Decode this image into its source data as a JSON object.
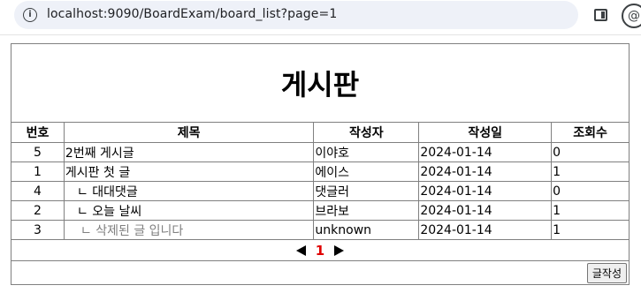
{
  "browser": {
    "url": "localhost:9090/BoardExam/board_list?page=1",
    "info_glyph": "i",
    "profile_glyph": "@"
  },
  "board": {
    "title": "게시판",
    "headers": [
      "번호",
      "제목",
      "작성자",
      "작성일",
      "조회수"
    ],
    "rows": [
      {
        "num": "5",
        "subject": "2번째 게시글",
        "writer": "이야호",
        "date": "2024-01-14",
        "views": "0"
      },
      {
        "num": "1",
        "subject": "게시판 첫 글",
        "writer": "에이스",
        "date": "2024-01-14",
        "views": "1"
      },
      {
        "num": "4",
        "subject": "ㄴ 대대댓글",
        "writer": "댓글러",
        "date": "2024-01-14",
        "views": "0"
      },
      {
        "num": "2",
        "subject": "ㄴ 오늘 날씨",
        "writer": "브라보",
        "date": "2024-01-14",
        "views": "1"
      },
      {
        "num": "3",
        "subject": "ㄴ 삭제된 글 입니다",
        "writer": "unknown",
        "date": "2024-01-14",
        "views": "1"
      }
    ],
    "pagination": {
      "current": "1"
    },
    "write_button": "글작성"
  },
  "colors": {
    "deleted_text": "#808080",
    "current_page": "#e00000",
    "border": "#808080"
  },
  "icons": [
    "info-icon",
    "side-panel-icon",
    "profile-icon",
    "prev-page-icon",
    "next-page-icon"
  ]
}
